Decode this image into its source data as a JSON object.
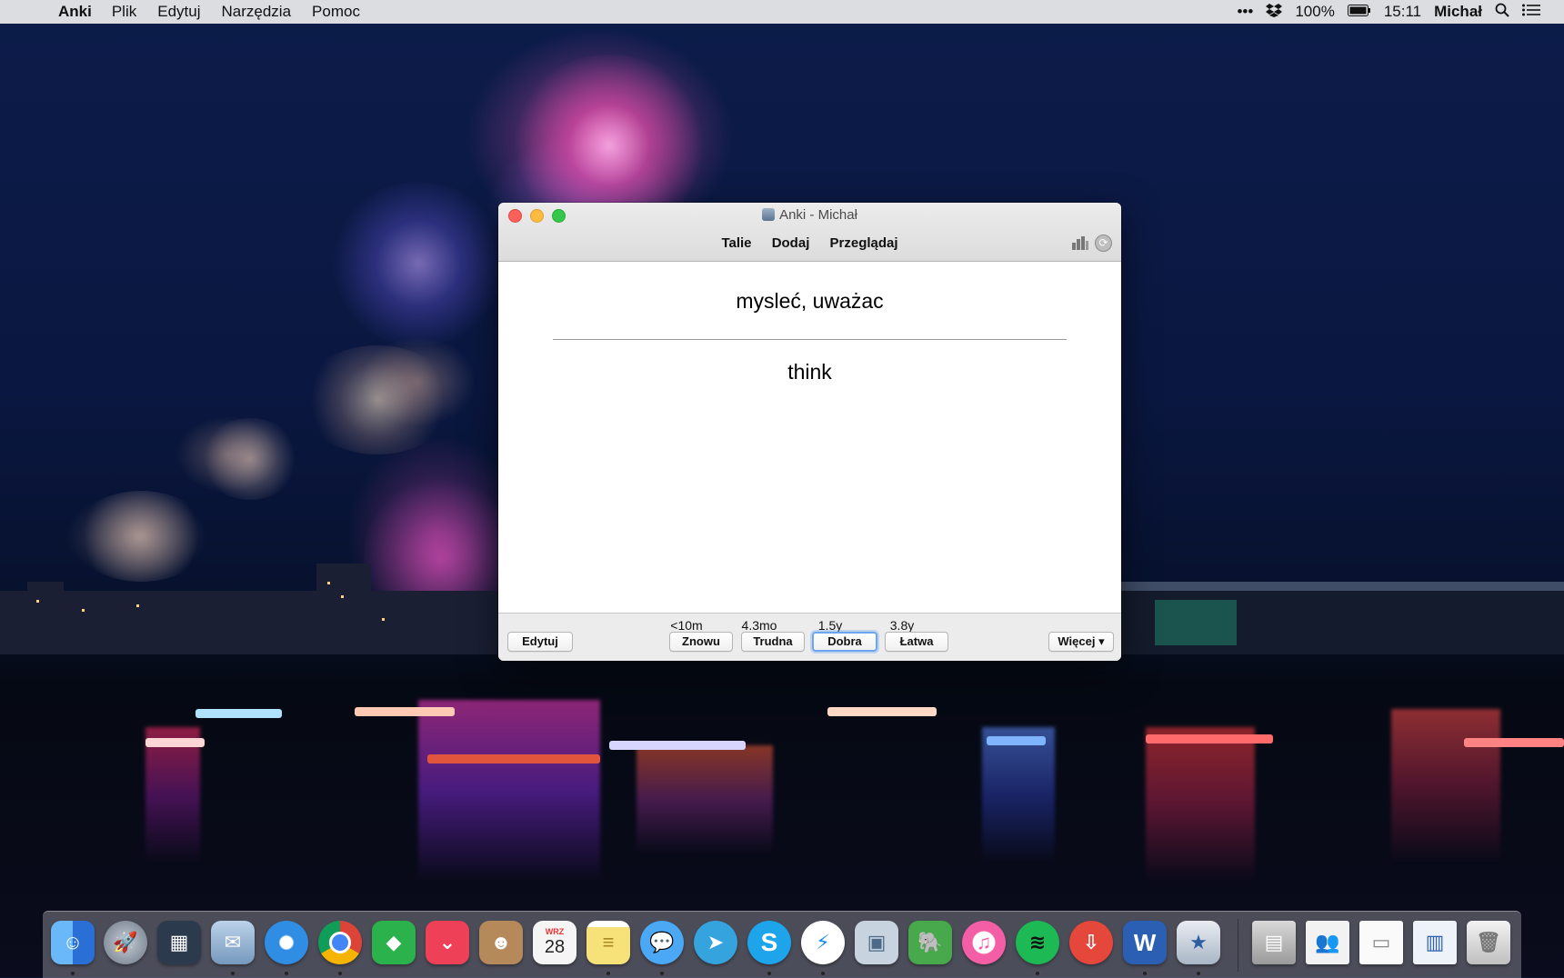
{
  "menubar": {
    "app_name": "Anki",
    "menus": [
      "Plik",
      "Edytuj",
      "Narzędzia",
      "Pomoc"
    ],
    "status": {
      "more": "•••",
      "battery": "100%",
      "time": "15:11",
      "user": "Michał"
    }
  },
  "window": {
    "title": "Anki - Michał",
    "toolbar": [
      "Talie",
      "Dodaj",
      "Przeglądaj"
    ],
    "card": {
      "question": "mysleć, uważac",
      "answer": "think"
    },
    "buttons": {
      "edit": "Edytuj",
      "more": "Więcej ▾"
    },
    "answers": [
      {
        "interval": "<10m",
        "label": "Znowu"
      },
      {
        "interval": "4.3mo",
        "label": "Trudna"
      },
      {
        "interval": "1.5y",
        "label": "Dobra"
      },
      {
        "interval": "3.8y",
        "label": "Łatwa"
      }
    ]
  },
  "dock": {
    "calendar_month": "WRZ",
    "calendar_day": "28",
    "apps": [
      {
        "name": "finder",
        "color": "#3b8eea"
      },
      {
        "name": "launchpad",
        "color": "#7d8895"
      },
      {
        "name": "mission-control",
        "color": "#2b3a4c"
      },
      {
        "name": "mail",
        "color": "#8fb2d6"
      },
      {
        "name": "safari",
        "color": "#2f8de4"
      },
      {
        "name": "chrome",
        "color": "#e4e4e4"
      },
      {
        "name": "feedly",
        "color": "#2bb24c"
      },
      {
        "name": "pocket",
        "color": "#ee4056"
      },
      {
        "name": "contacts",
        "color": "#b5895a"
      },
      {
        "name": "calendar",
        "color": "#f5f5f5"
      },
      {
        "name": "notes",
        "color": "#f7e27a"
      },
      {
        "name": "messages",
        "color": "#4aa8f5"
      },
      {
        "name": "telegram",
        "color": "#35a3de"
      },
      {
        "name": "skype",
        "color": "#1ea4eb"
      },
      {
        "name": "messenger",
        "color": "#1b8cf2"
      },
      {
        "name": "preview",
        "color": "#c7d4e0"
      },
      {
        "name": "evernote",
        "color": "#47a94b"
      },
      {
        "name": "itunes",
        "color": "#f35ea6"
      },
      {
        "name": "spotify",
        "color": "#1db954"
      },
      {
        "name": "transmit",
        "color": "#e5483b"
      },
      {
        "name": "word",
        "color": "#2b5fb4"
      },
      {
        "name": "anki",
        "color": "#d8dde6"
      }
    ]
  }
}
